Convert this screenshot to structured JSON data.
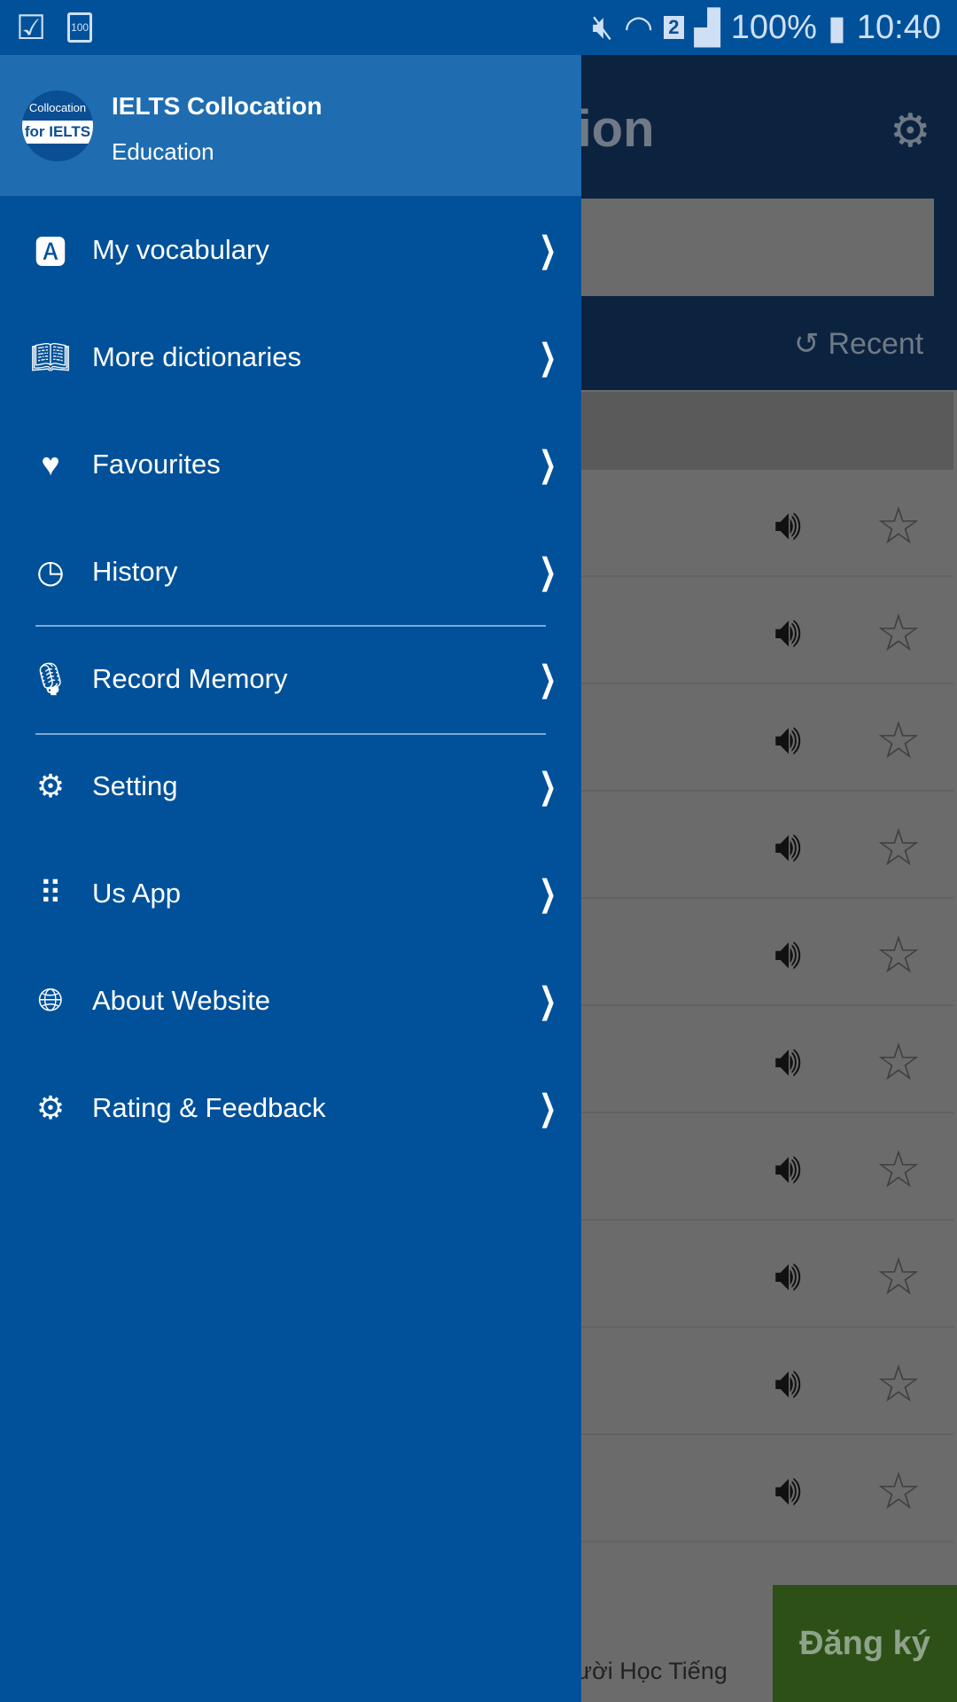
{
  "status_bar": {
    "battery_icon_text": "100",
    "sim": "2",
    "battery": "100%",
    "time": "10:40"
  },
  "background_app": {
    "title_fragment": "ation",
    "recent_label": "Recent",
    "speaker_rows": 10,
    "ad_text": "ười Học Tiếng",
    "ad_button": "Đăng ký"
  },
  "drawer": {
    "app_name": "IELTS Collocation",
    "category": "Education",
    "logo_text": "Collocation for IELTS",
    "items": [
      {
        "label": "My vocabulary",
        "icon": "letter-a-icon"
      },
      {
        "label": "More dictionaries",
        "icon": "dictionary-icon"
      },
      {
        "label": "Favourites",
        "icon": "heart-icon"
      },
      {
        "label": "History",
        "icon": "history-icon"
      },
      {
        "label": "Record Memory",
        "icon": "microphone-icon"
      },
      {
        "label": "Setting",
        "icon": "gear-icon"
      },
      {
        "label": "Us App",
        "icon": "grid-icon"
      },
      {
        "label": "About Website",
        "icon": "globe-icon"
      },
      {
        "label": "Rating & Feedback",
        "icon": "gear-icon"
      }
    ]
  },
  "colors": {
    "drawer": "#01519a",
    "header": "#1f6db0",
    "ad_button": "#2d5016"
  }
}
